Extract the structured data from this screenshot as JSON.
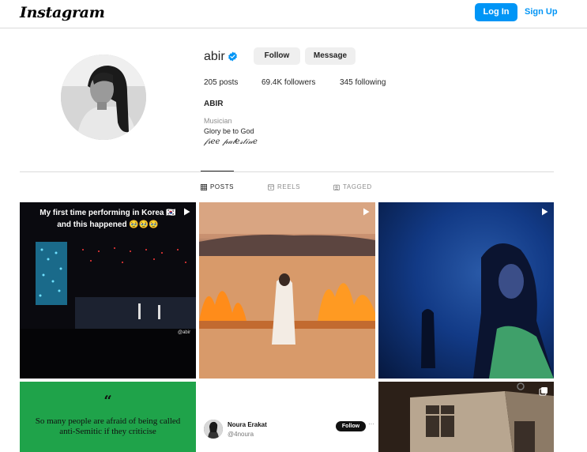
{
  "header": {
    "logo": "Instagram",
    "login_label": "Log In",
    "signup_label": "Sign Up"
  },
  "profile": {
    "username": "abir",
    "verified": true,
    "follow_label": "Follow",
    "message_label": "Message",
    "stats": {
      "posts": "205 posts",
      "followers": "69.4K followers",
      "following": "345 following"
    },
    "full_name": "ABIR",
    "category": "Musician",
    "bio_line1": "Glory be to God",
    "bio_line2": "𝒻𝓇𝑒𝑒 𝓅𝒶𝓁𝑒𝓈𝓉𝒾𝓃𝑒"
  },
  "tabs": [
    {
      "label": "POSTS",
      "active": true,
      "icon": "grid-icon"
    },
    {
      "label": "REELS",
      "active": false,
      "icon": "reels-icon"
    },
    {
      "label": "TAGGED",
      "active": false,
      "icon": "tagged-icon"
    }
  ],
  "posts": [
    {
      "type": "reel",
      "caption_line1": "My first time performing in Korea 🇰🇷",
      "caption_line2": "and this happened 🥹🥹🥹",
      "overlay_text": "@abir"
    },
    {
      "type": "reel"
    },
    {
      "type": "reel"
    },
    {
      "type": "image",
      "quote_mark": "“",
      "quote_text": "So many people are afraid of being called anti-Semitic if they criticise"
    },
    {
      "type": "image",
      "tweet_name": "Noura Erakat",
      "tweet_handle": "@4noura",
      "tweet_follow": "Follow",
      "tweet_more": "···"
    },
    {
      "type": "carousel"
    }
  ],
  "colors": {
    "accent": "#0095f6",
    "verified": "#0095f6",
    "button_bg": "#efefef",
    "muted": "#8e8e8e"
  }
}
